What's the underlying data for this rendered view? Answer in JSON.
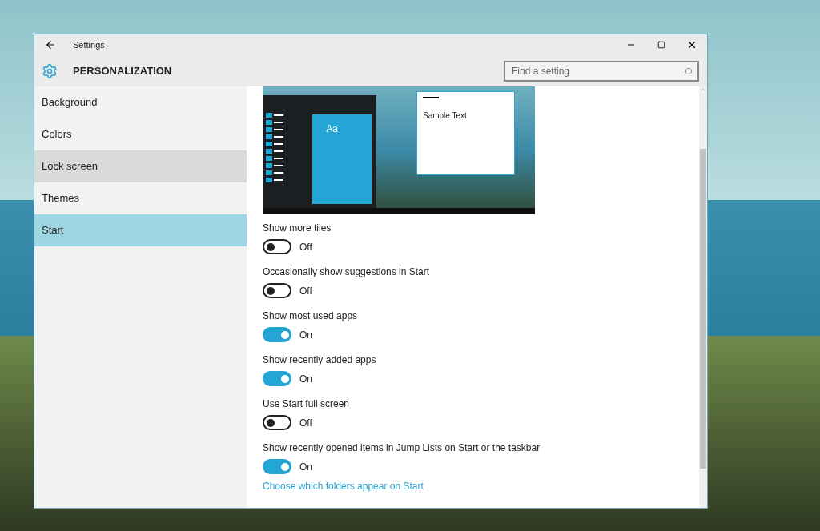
{
  "window": {
    "title": "Settings",
    "section": "PERSONALIZATION",
    "search": {
      "placeholder": "Find a setting"
    }
  },
  "sidebar": {
    "items": [
      {
        "label": "Background",
        "selected": false,
        "hovered": false
      },
      {
        "label": "Colors",
        "selected": false,
        "hovered": false
      },
      {
        "label": "Lock screen",
        "selected": false,
        "hovered": true
      },
      {
        "label": "Themes",
        "selected": false,
        "hovered": false
      },
      {
        "label": "Start",
        "selected": true,
        "hovered": false
      }
    ]
  },
  "preview": {
    "tile_label": "Aa",
    "sample_text": "Sample Text"
  },
  "toggles": [
    {
      "label": "Show more tiles",
      "on": false,
      "state_text": "Off"
    },
    {
      "label": "Occasionally show suggestions in Start",
      "on": false,
      "state_text": "Off"
    },
    {
      "label": "Show most used apps",
      "on": true,
      "state_text": "On"
    },
    {
      "label": "Show recently added apps",
      "on": true,
      "state_text": "On"
    },
    {
      "label": "Use Start full screen",
      "on": false,
      "state_text": "Off"
    },
    {
      "label": "Show recently opened items in Jump Lists on Start or the taskbar",
      "on": true,
      "state_text": "On"
    }
  ],
  "link": "Choose which folders appear on Start"
}
